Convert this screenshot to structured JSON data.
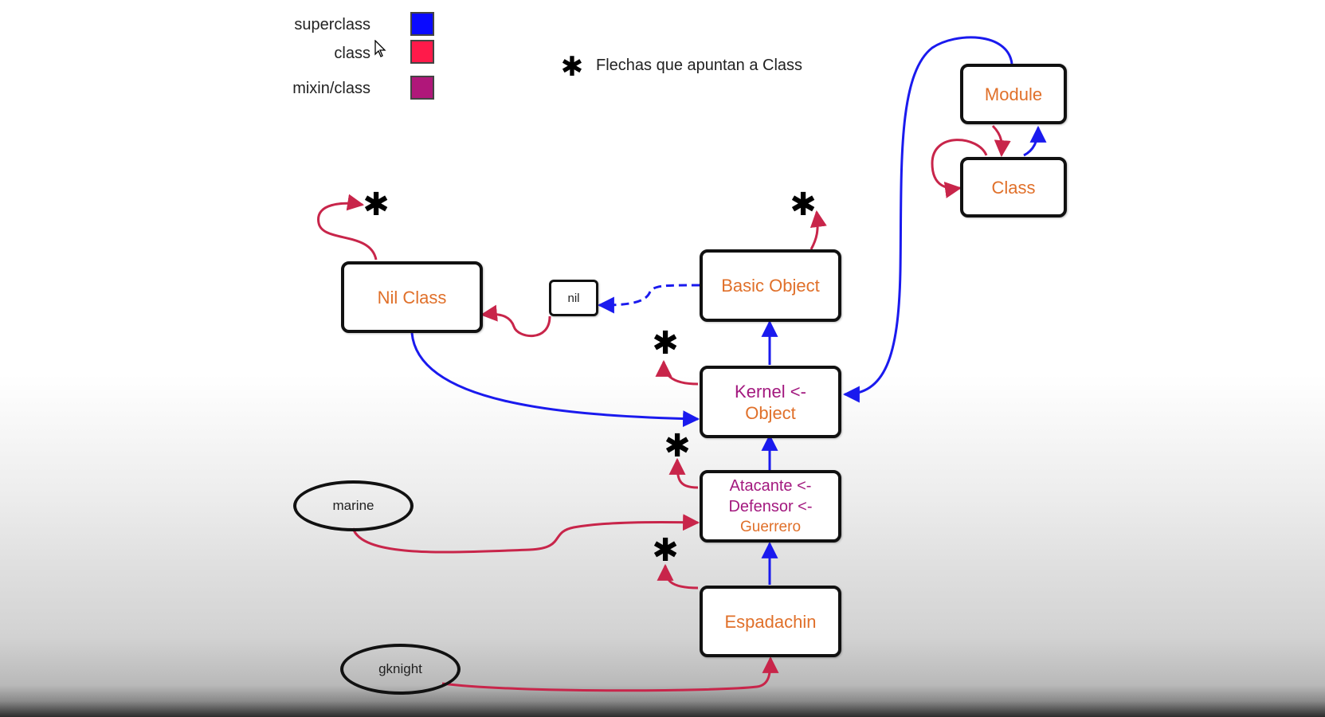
{
  "legend": {
    "items": [
      {
        "label": "superclass",
        "color": "#0a0aff"
      },
      {
        "label": "class",
        "color": "#ff1a4a"
      },
      {
        "label": "mixin/class",
        "color": "#b0177a"
      }
    ],
    "note": {
      "symbol": "✱",
      "text": "Flechas que apuntan a Class"
    }
  },
  "colors": {
    "superclass_edge": "#1a1aee",
    "class_edge": "#c8254a",
    "mixin_text": "#a3197f",
    "class_text": "#e0702a"
  },
  "nodes": {
    "module": "Module",
    "class": "Class",
    "basic_object": "Basic Object",
    "nil_class": "Nil Class",
    "nil": "nil",
    "kernel_object": {
      "line1": "Kernel <-",
      "line2": "Object"
    },
    "atacante": {
      "line1": "Atacante <-",
      "line2": "Defensor <-",
      "line3": "Guerrero"
    },
    "espadachin": "Espadachin",
    "marine": "marine",
    "gknight": "gknight"
  },
  "star_symbol": "✱"
}
